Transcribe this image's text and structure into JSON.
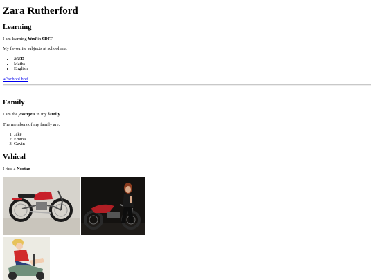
{
  "page": {
    "title": "Zara Rutherford"
  },
  "learning": {
    "heading": "Learning",
    "sentence": {
      "prefix": "I am learning ",
      "subject": "html",
      "middle": " in ",
      "class_name": "9DIT"
    },
    "subjects_intro": "My favourite subjects at school are:",
    "subjects": [
      "MED",
      "Maths",
      "English"
    ],
    "link_text": "w3school href"
  },
  "family": {
    "heading": "Family",
    "sentence": {
      "prefix": "I am the ",
      "position": "youngest",
      "middle": " in my ",
      "word": "family"
    },
    "members_intro": "The members of my family are:",
    "members": [
      "Jake",
      "Emma",
      "Gavin"
    ]
  },
  "vehicle": {
    "heading": "Vehical",
    "sentence": {
      "prefix": "I ride a ",
      "brand": "Nortan"
    },
    "images": [
      {
        "name": "red-motorcycle-photo",
        "background": "#d6d3cc"
      },
      {
        "name": "rider-on-motorcycle-photo",
        "background": "#141210"
      },
      {
        "name": "pinup-scooter-illustration",
        "background": "#ecebe3"
      }
    ]
  },
  "colors": {
    "link": "#0000ee",
    "tank_red": "#c8202a",
    "text": "#000000"
  }
}
